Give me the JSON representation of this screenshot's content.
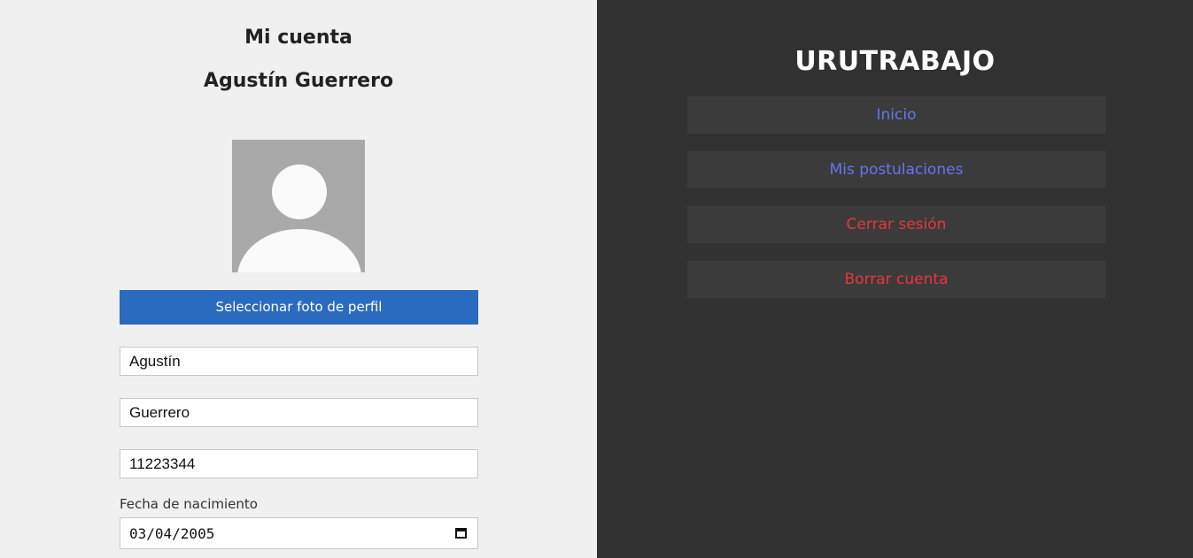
{
  "account": {
    "heading": "Mi cuenta",
    "user_name": "Agustín Guerrero",
    "avatar_icon": "user-placeholder-icon",
    "select_photo_label": "Seleccionar foto de perfil",
    "first_name_value": "Agustín",
    "last_name_value": "Guerrero",
    "document_value": "11223344",
    "birth_date_label": "Fecha de nacimiento",
    "birth_date_value": "03/04/2005",
    "calendar_icon": "calendar-icon"
  },
  "sidebar": {
    "brand": "URUTRABAJO",
    "items": [
      {
        "label": "Inicio",
        "color": "#6676f0"
      },
      {
        "label": "Mis postulaciones",
        "color": "#6676f0"
      },
      {
        "label": "Cerrar sesión",
        "color": "#e8353f"
      },
      {
        "label": "Borrar cuenta",
        "color": "#e8353f"
      }
    ]
  },
  "colors": {
    "primary_button": "#2a6bbf",
    "sidebar_bg": "#313131",
    "nav_item_bg": "#3b3b3b",
    "content_bg": "#f0f0f0"
  }
}
